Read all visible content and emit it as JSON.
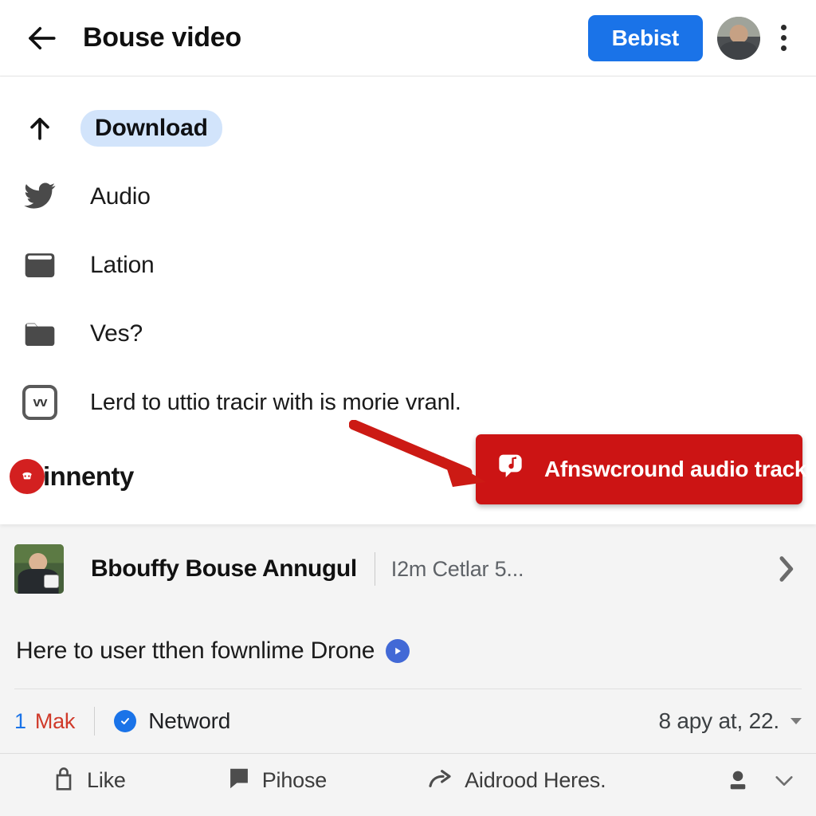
{
  "header": {
    "back_icon": "back-arrow-icon",
    "title": "Bouse video",
    "primary_button": "Bebist",
    "avatar": "user-avatar",
    "menu_icon": "kebab-menu-icon",
    "accent_color": "#1a73e8"
  },
  "options": [
    {
      "icon": "upload-arrow-icon",
      "label": "Download",
      "highlighted": true
    },
    {
      "icon": "bird-icon",
      "label": "Audio",
      "highlighted": false
    },
    {
      "icon": "wallet-icon",
      "label": "Lation",
      "highlighted": false
    },
    {
      "icon": "folder-icon",
      "label": "Ves?",
      "highlighted": false
    },
    {
      "icon": "vv-badge-icon",
      "label": "Lerd to uttio tracir with is morie vranl.",
      "highlighted": false
    }
  ],
  "brand": {
    "icon": "red-circle-logo-icon",
    "label": "innenty"
  },
  "cta": {
    "icon": "audio-track-icon",
    "label": "Afnswcround audio track",
    "color": "#cc1414",
    "annotation": "red-pointer-arrow"
  },
  "post": {
    "thumbnail": "post-thumbnail",
    "author": "Bbouffy Bouse Annugul",
    "meta": "I2m Cetlar 5...",
    "chevron": "chevron-right-icon",
    "text": "Here to user tthen fownlime Drone",
    "play_icon": "play-circle-icon"
  },
  "stats": {
    "count": "1",
    "count_label": "Mak",
    "verified_icon": "verified-check-icon",
    "network_label": "Netword",
    "right_label": "8 apy at, 22.",
    "dropdown_icon": "caret-down-icon"
  },
  "actions": [
    {
      "icon": "like-icon",
      "label": "Like"
    },
    {
      "icon": "comment-icon",
      "label": "Pihose"
    },
    {
      "icon": "share-icon",
      "label": "Aidrood Heres."
    }
  ],
  "action_trailing": {
    "person_icon": "person-icon",
    "chevron_icon": "chevron-down-icon"
  }
}
